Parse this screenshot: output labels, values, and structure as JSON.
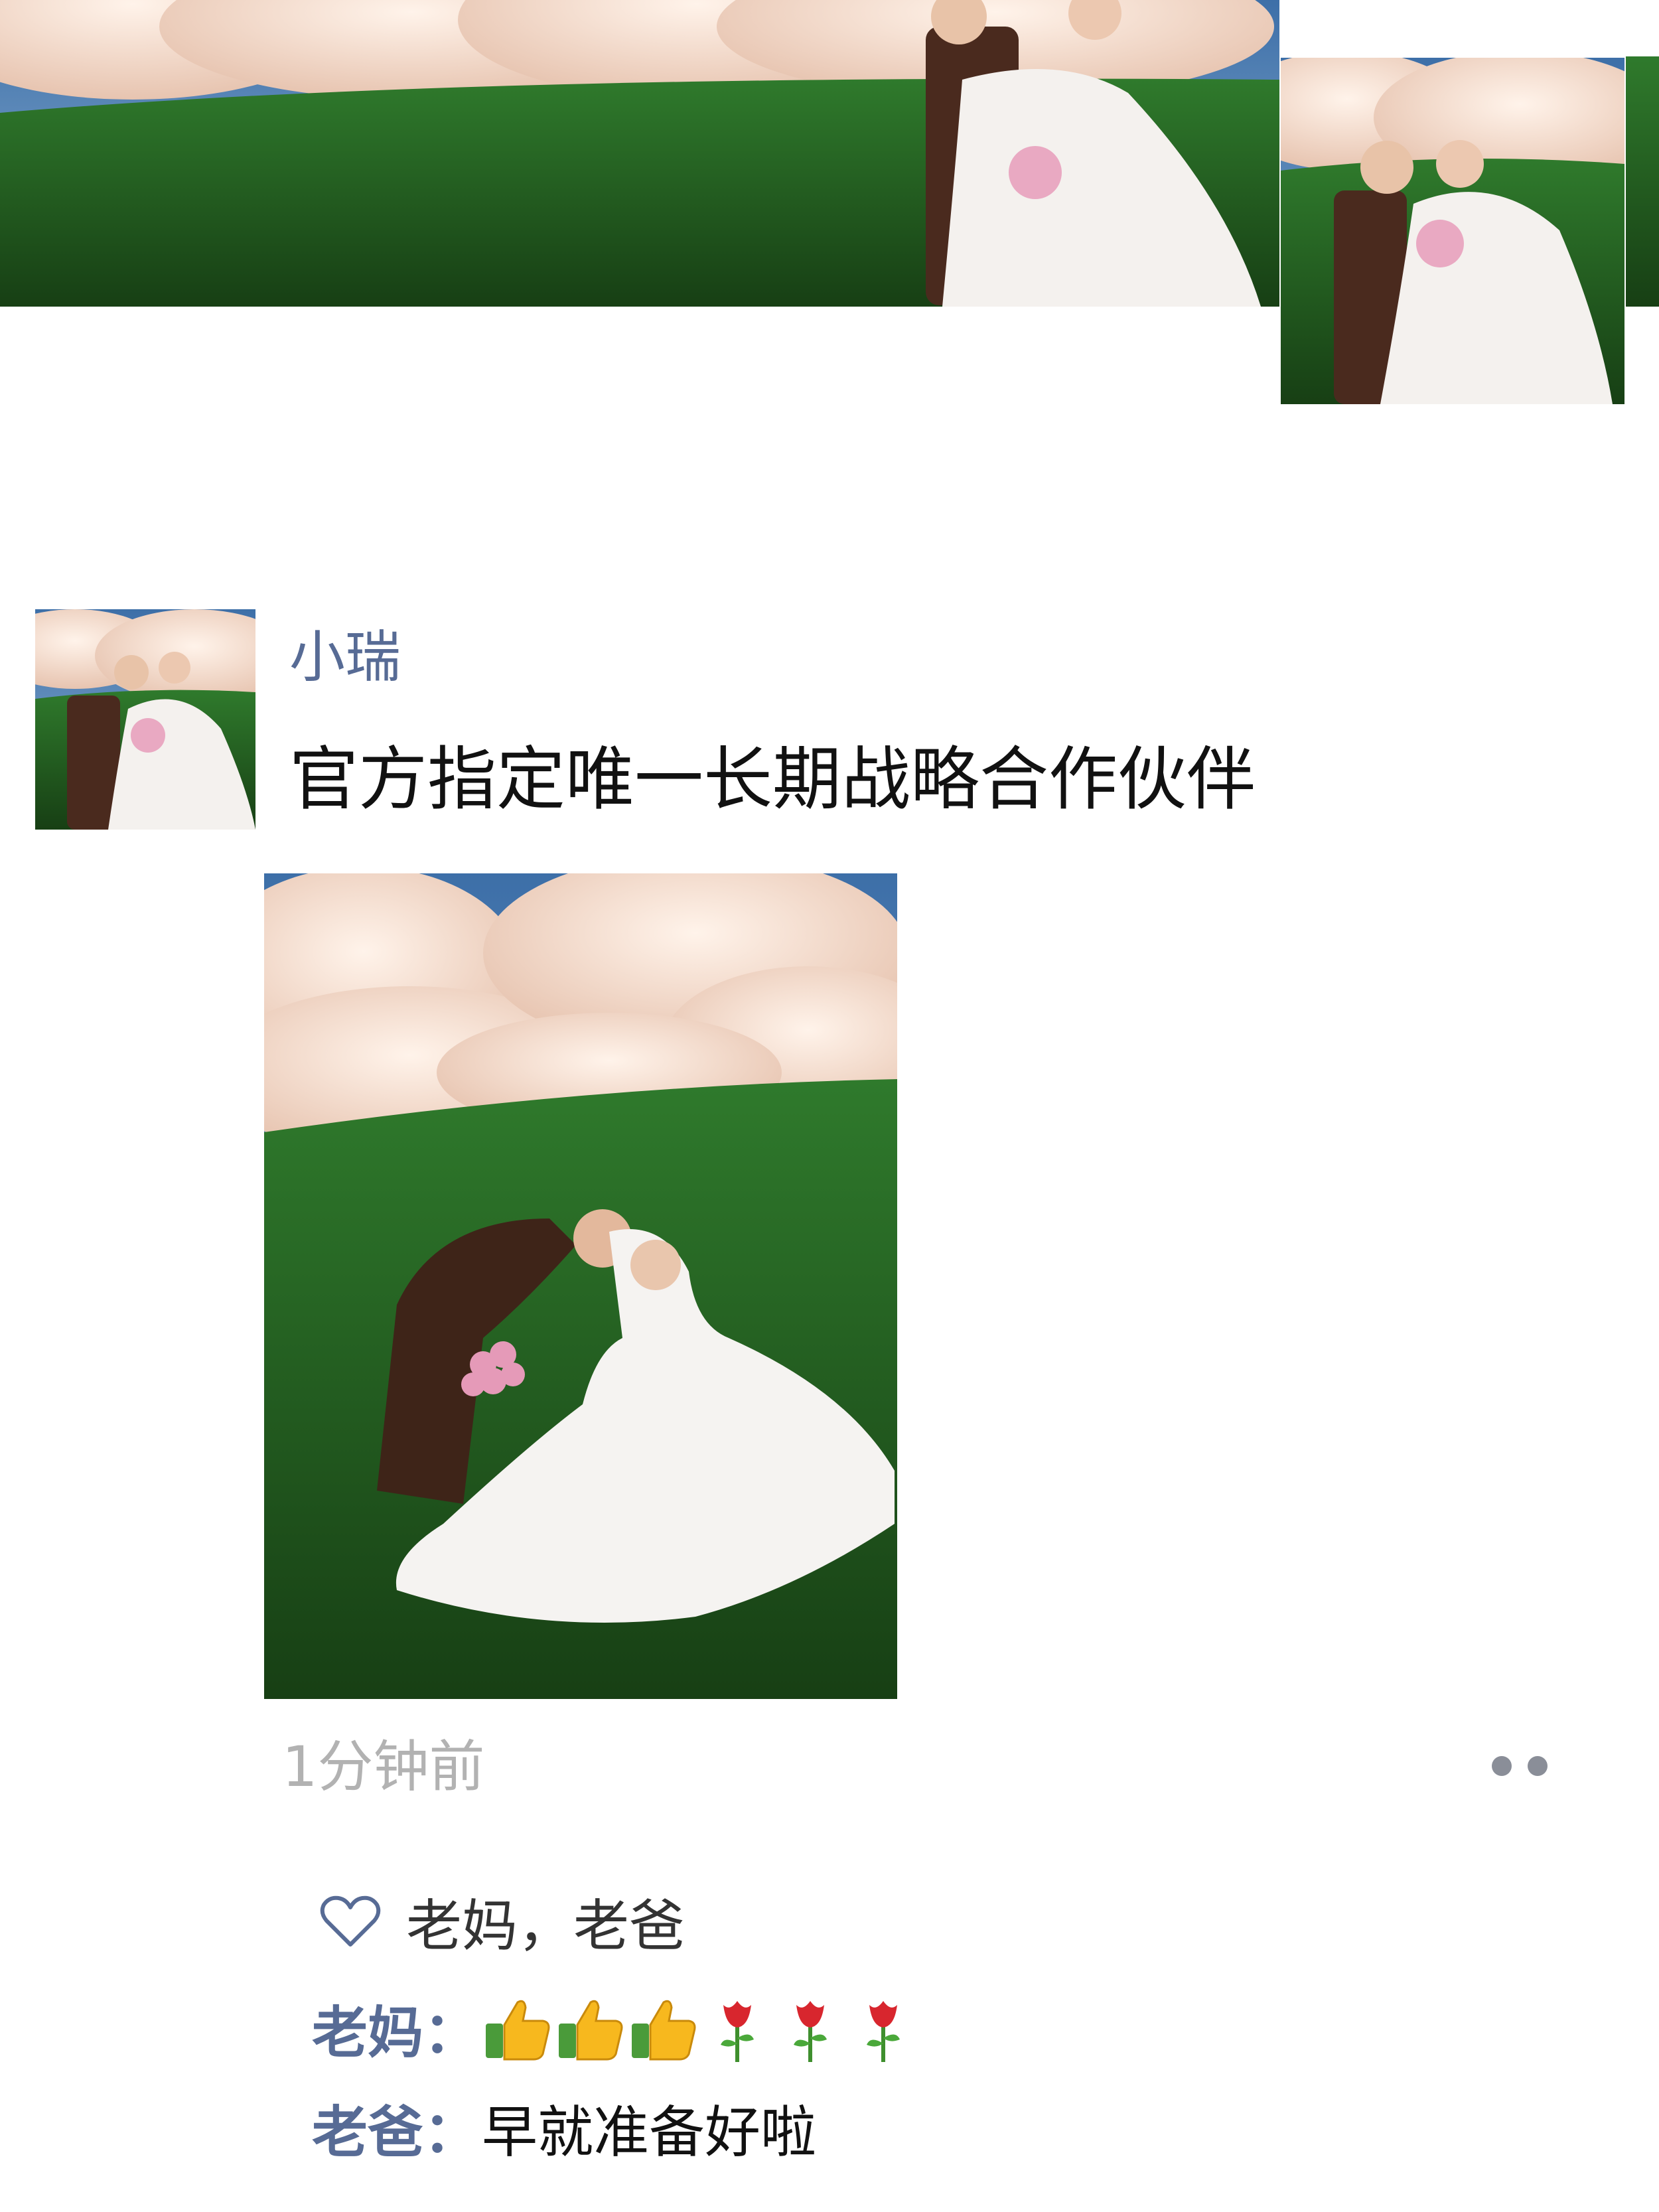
{
  "theme": {
    "name_color": "#576b95",
    "text_color": "#111111",
    "meta_color": "#b2b2b2",
    "background": "#ffffff"
  },
  "cover": {
    "icon": "cover-photo"
  },
  "post": {
    "username": "小瑞",
    "text": "官方指定唯一长期战略合作伙伴",
    "photo_icon": "wedding-photo",
    "timestamp": "1分钟前",
    "more_icon": "more-dots-icon"
  },
  "likes": {
    "icon": "heart-icon",
    "names": "老妈，老爸"
  },
  "comments": [
    {
      "author": "老妈",
      "separator": "：",
      "emoji": [
        "thumbs-up",
        "thumbs-up",
        "thumbs-up",
        "rose",
        "rose",
        "rose"
      ]
    },
    {
      "author": "老爸",
      "separator": "：",
      "text": "早就准备好啦"
    }
  ]
}
